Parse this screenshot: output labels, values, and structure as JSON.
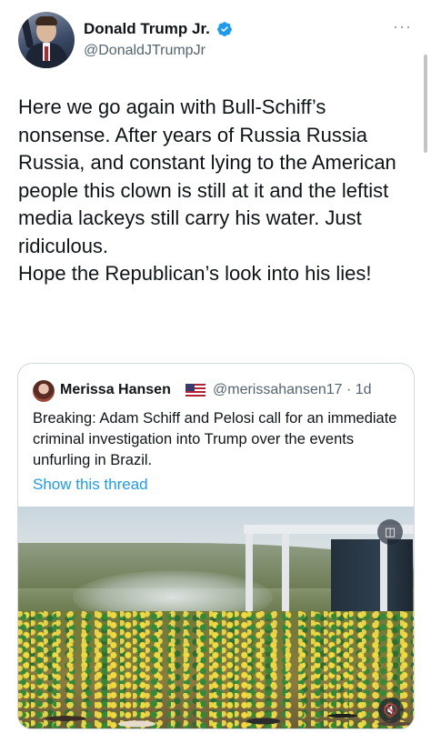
{
  "tweet": {
    "author_name": "Donald Trump Jr.",
    "author_handle": "@DonaldJTrumpJr",
    "text": "Here we go again with Bull-Schiff’s nonsense. After years of Russia Russia Russia, and constant lying to the American people this clown is still at it and the leftist media lackeys still carry his water. Just ridiculous.\nHope the Republican’s look into his lies!",
    "more_icon": "more-dots-icon",
    "verified_icon": "verified-badge-icon",
    "verified_color": "#1d9bf0"
  },
  "quote": {
    "author_name": "Merissa Hansen",
    "flag_icon": "us-flag-icon",
    "handle_time": "@merissahansen17 · 1d",
    "text": "Breaking: Adam Schiff and Pelosi call for an immediate criminal investigation into Trump over the events unfurling in Brazil.",
    "show_thread": "Show this thread",
    "link_color": "#1d9bf0",
    "media": {
      "sound_icon": "muted-speaker-icon",
      "badge_icon": "media-badge-icon"
    }
  }
}
